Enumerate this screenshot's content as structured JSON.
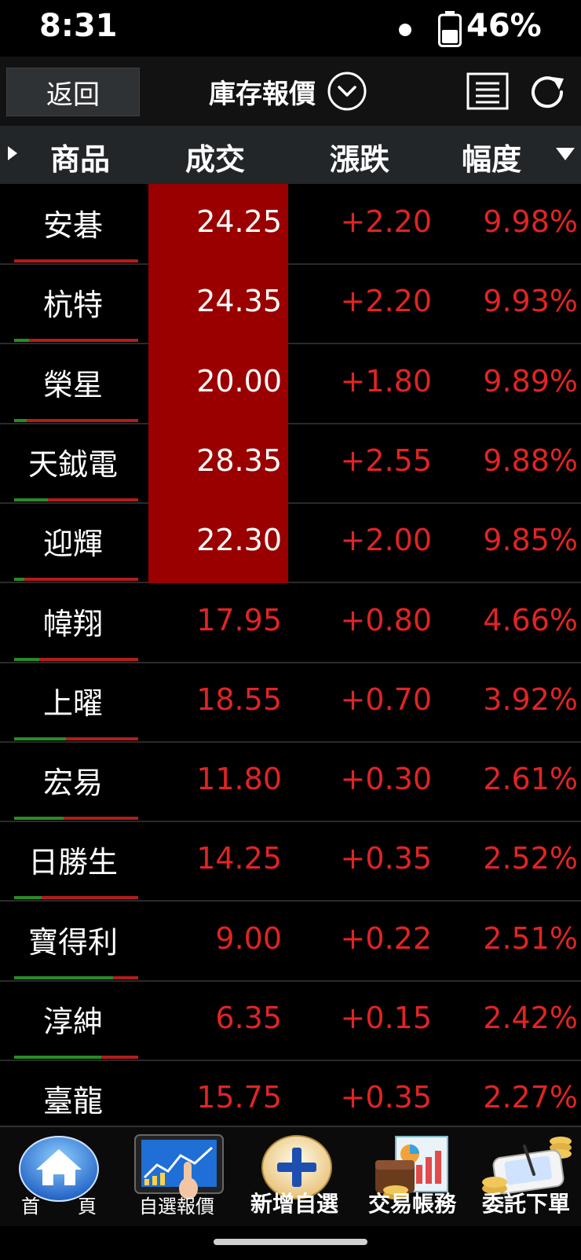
{
  "status_bar": {
    "time": "8:31",
    "battery": "46%"
  },
  "nav": {
    "back_label": "返回",
    "title": "庫存報價"
  },
  "table": {
    "headers": {
      "name": "商品",
      "price": "成交",
      "change": "漲跌",
      "pct": "幅度"
    },
    "rows": [
      {
        "name": "安碁",
        "price": "24.25",
        "change": "+2.20",
        "pct": "9.98%",
        "limit_up": true,
        "ratio_green": 0.0
      },
      {
        "name": "杭特",
        "price": "24.35",
        "change": "+2.20",
        "pct": "9.93%",
        "limit_up": true,
        "ratio_green": 0.12
      },
      {
        "name": "榮星",
        "price": "20.00",
        "change": "+1.80",
        "pct": "9.89%",
        "limit_up": true,
        "ratio_green": 0.1
      },
      {
        "name": "天鉞電",
        "price": "28.35",
        "change": "+2.55",
        "pct": "9.88%",
        "limit_up": true,
        "ratio_green": 0.27
      },
      {
        "name": "迎輝",
        "price": "22.30",
        "change": "+2.00",
        "pct": "9.85%",
        "limit_up": true,
        "ratio_green": 0.08
      },
      {
        "name": "幃翔",
        "price": "17.95",
        "change": "+0.80",
        "pct": "4.66%",
        "limit_up": false,
        "ratio_green": 0.2
      },
      {
        "name": "上曜",
        "price": "18.55",
        "change": "+0.70",
        "pct": "3.92%",
        "limit_up": false,
        "ratio_green": 0.42
      },
      {
        "name": "宏易",
        "price": "11.80",
        "change": "+0.30",
        "pct": "2.61%",
        "limit_up": false,
        "ratio_green": 0.4
      },
      {
        "name": "日勝生",
        "price": "14.25",
        "change": "+0.35",
        "pct": "2.52%",
        "limit_up": false,
        "ratio_green": 0.22
      },
      {
        "name": "寶得利",
        "price": "9.00",
        "change": "+0.22",
        "pct": "2.51%",
        "limit_up": false,
        "ratio_green": 0.8
      },
      {
        "name": "淳紳",
        "price": "6.35",
        "change": "+0.15",
        "pct": "2.42%",
        "limit_up": false,
        "ratio_green": 0.7
      },
      {
        "name": "臺龍",
        "price": "15.75",
        "change": "+0.35",
        "pct": "2.27%",
        "limit_up": false,
        "ratio_green": 0.3
      }
    ]
  },
  "toolbar": {
    "home": "首　　頁",
    "watchlist": "自選報價",
    "add_watch": "新增自選",
    "account": "交易帳務",
    "order": "委託下單"
  },
  "colors": {
    "up_red": "#e02424",
    "limit_bg": "#9a0000",
    "header_bg": "#232629"
  }
}
